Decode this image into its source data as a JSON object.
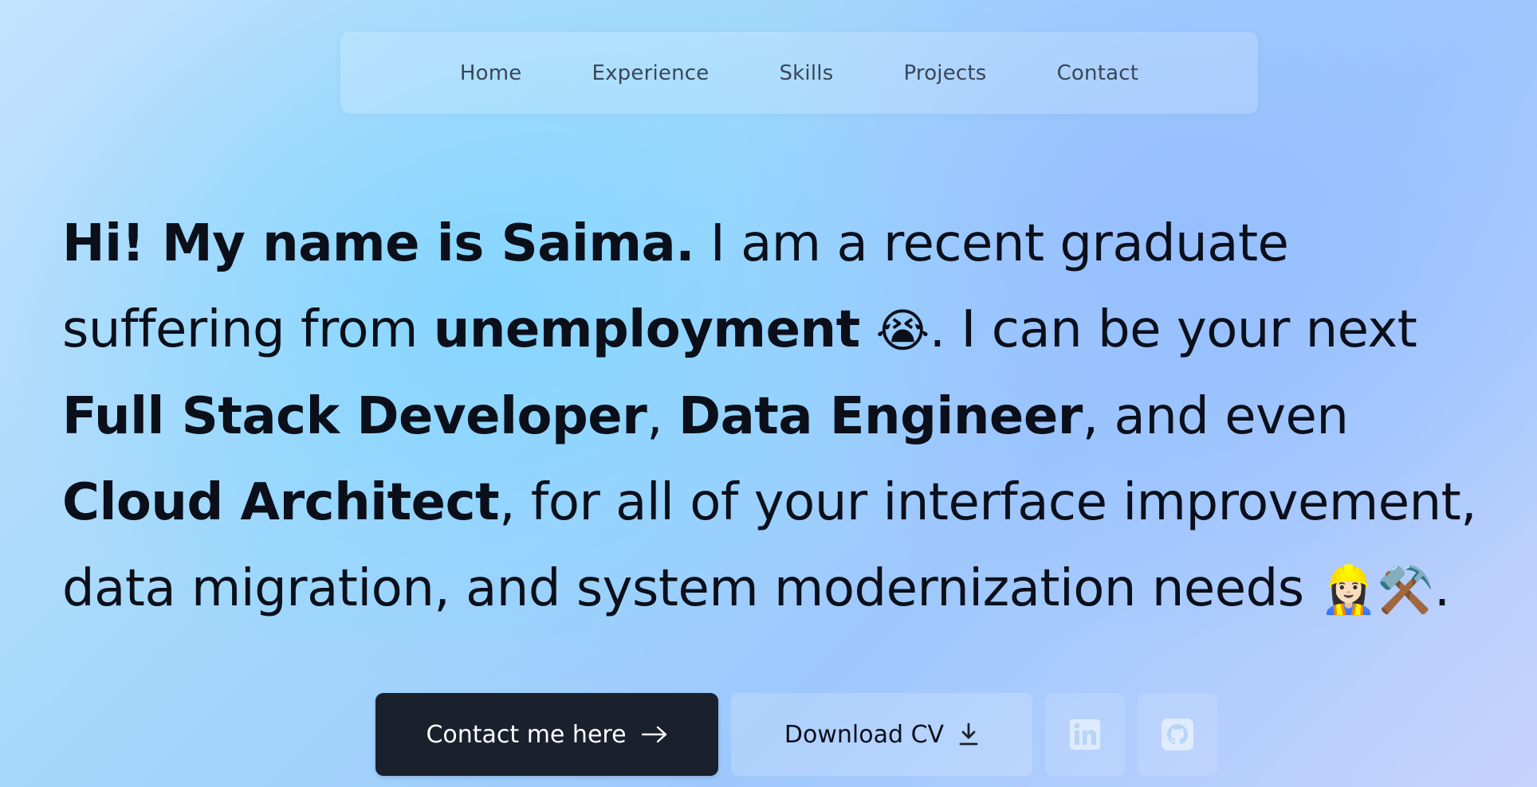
{
  "nav": {
    "items": [
      {
        "label": "Home"
      },
      {
        "label": "Experience"
      },
      {
        "label": "Skills"
      },
      {
        "label": "Projects"
      },
      {
        "label": "Contact"
      }
    ]
  },
  "hero": {
    "greeting": "Hi! My name is Saima.",
    "t1": " I am a recent graduate suffering from ",
    "unemployment": "unemployment",
    "crying_emoji": "😭",
    "t2": ". I can be your next ",
    "role1": "Full Stack Developer",
    "t3": ", ",
    "role2": "Data Engineer",
    "t4": ", and even ",
    "role3": "Cloud Architect",
    "t5": ", for all of your interface improvement, data migration, and system modernization needs ",
    "worker_emoji": "👷🏻‍♀️",
    "tools_emoji": "⚒️",
    "t6": "."
  },
  "buttons": {
    "contact_label": "Contact me here",
    "cv_label": "Download CV",
    "contact_icon": "arrow-right-icon",
    "cv_icon": "download-icon",
    "linkedin_icon": "linkedin-icon",
    "github_icon": "github-icon"
  },
  "colors": {
    "primary_button": "#1a202c",
    "text": "#0a0f1a",
    "nav_text": "#3a4658"
  }
}
